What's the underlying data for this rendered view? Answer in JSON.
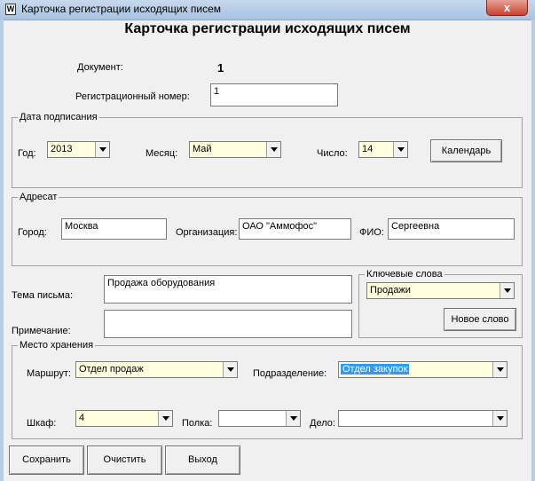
{
  "window": {
    "title": "Карточка регистрации исходящих писем",
    "icon_letter": "W",
    "close_glyph": "x"
  },
  "form": {
    "heading": "Карточка регистрации исходящих писем",
    "document_label": "Документ:",
    "document_value": "1",
    "reg_number_label": "Регистрационный номер:",
    "reg_number_value": "1"
  },
  "signing_date": {
    "legend": "Дата подписания",
    "year_label": "Год:",
    "year_value": "2013",
    "month_label": "Месяц:",
    "month_value": "Май",
    "day_label": "Число:",
    "day_value": "14",
    "calendar_button": "Календарь"
  },
  "addressee": {
    "legend": "Адресат",
    "city_label": "Город:",
    "city_value": "Москва",
    "org_label": "Организация:",
    "org_value": "ОАО \"Аммофос\"",
    "fio_label": "ФИО:",
    "fio_value": "Сергеевна"
  },
  "letter": {
    "subject_label": "Тема письма:",
    "subject_value": "Продажа оборудования",
    "note_label": "Примечание:",
    "note_value": ""
  },
  "keywords": {
    "legend": "Ключевые слова",
    "value": "Продажи",
    "new_word_button": "Новое слово"
  },
  "storage": {
    "legend": "Место хранения",
    "route_label": "Маршрут:",
    "route_value": "Отдел продаж",
    "dept_label": "Подразделение:",
    "dept_value": "Отдел закупок",
    "cabinet_label": "Шкаф:",
    "cabinet_value": "4",
    "shelf_label": "Полка:",
    "shelf_value": "",
    "case_label": "Дело:",
    "case_value": ""
  },
  "actions": {
    "save": "Сохранить",
    "clear": "Очистить",
    "exit": "Выход"
  },
  "colors": {
    "combo_background": "#ffffe0",
    "selection": "#3399ff",
    "close_button": "#c7432f"
  }
}
